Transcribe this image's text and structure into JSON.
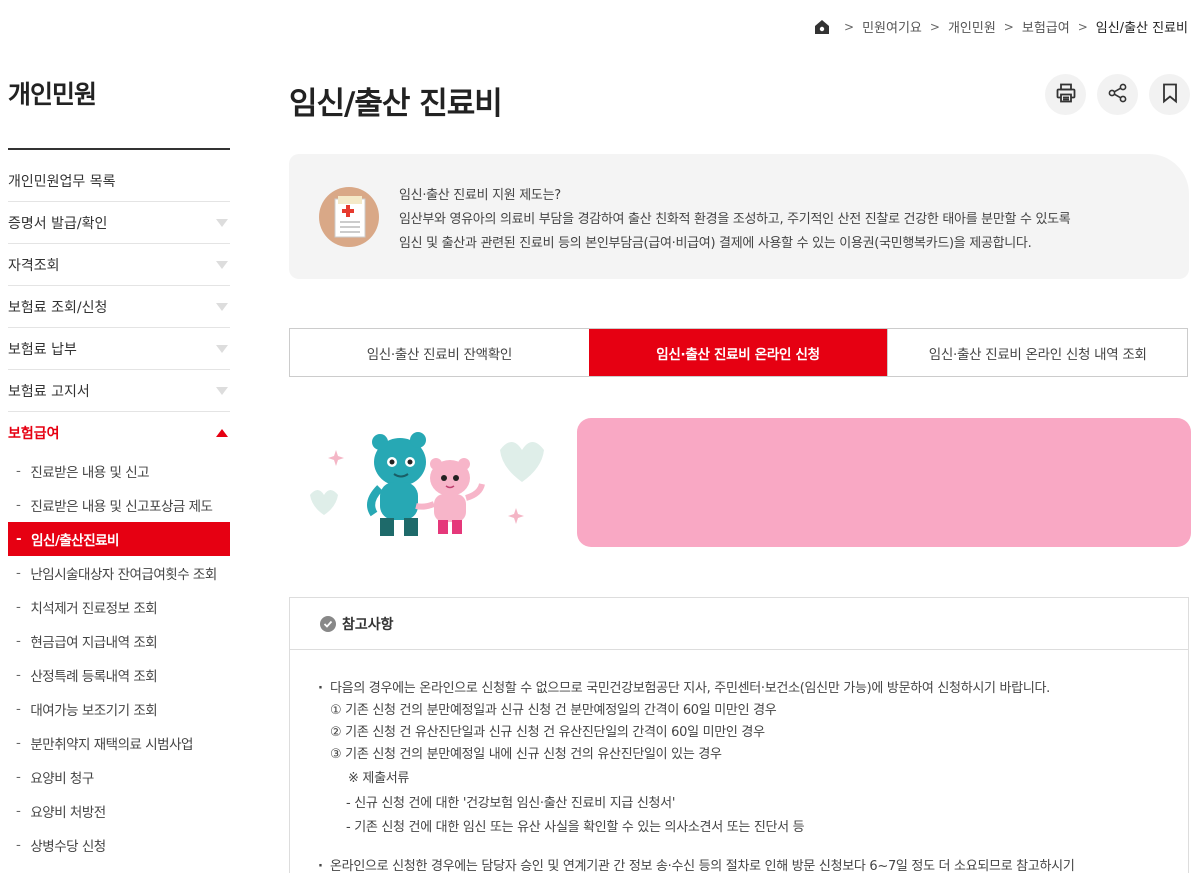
{
  "breadcrumb": {
    "items": [
      "민원여기요",
      "개인민원",
      "보험급여",
      "임신/출산 진료비"
    ]
  },
  "sidebar": {
    "title": "개인민원",
    "menu": [
      {
        "label": "개인민원업무 목록"
      },
      {
        "label": "증명서 발급/확인"
      },
      {
        "label": "자격조회"
      },
      {
        "label": "보험료 조회/신청"
      },
      {
        "label": "보험료 납부"
      },
      {
        "label": "보험료 고지서"
      },
      {
        "label": "보험급여"
      }
    ],
    "submenu": [
      "진료받은 내용 및 신고",
      "진료받은 내용 및 신고포상금 제도",
      "임신/출산진료비",
      "난임시술대상자 잔여급여횟수 조회",
      "치석제거 진료정보 조회",
      "현금급여 지급내역 조회",
      "산정특례 등록내역 조회",
      "대여가능 보조기기 조회",
      "분만취약지 재택의료 시범사업",
      "요양비 청구",
      "요양비 처방전",
      "상병수당 신청"
    ]
  },
  "page": {
    "title": "임신/출산 진료비"
  },
  "toolbar": {
    "print_icon": "print-icon",
    "share_icon": "share-icon",
    "bookmark_icon": "bookmark-icon"
  },
  "intro": {
    "line1": "임신·출산 진료비 지원 제도는?",
    "line2": "임산부와 영유아의 의료비 부담을 경감하여 출산 친화적 환경을 조성하고, 주기적인 산전 진찰로 건강한 태아를 분만할 수 있도록",
    "line3": "임신 및 출산과 관련된 진료비 등의 본인부담금(급여·비급여) 결제에 사용할 수 있는 이용권(국민행복카드)을 제공합니다."
  },
  "tabs": [
    {
      "label": "임신·출산 진료비 잔액확인"
    },
    {
      "label": "임신·출산 진료비 온라인 신청"
    },
    {
      "label": "임신·출산 진료비 온라인 신청 내역 조회"
    }
  ],
  "notice": {
    "title": "참고사항",
    "bullet1": "다음의 경우에는 온라인으로 신청할 수 없으므로 국민건강보험공단 지사, 주민센터·보건소(임신만 가능)에 방문하여 신청하시기 바랍니다.",
    "item1": "① 기존 신청 건의 분만예정일과 신규 신청 건 분만예정일의 간격이 60일 미만인 경우",
    "item2": "② 기존 신청 건 유산진단일과 신규 신청 건 유산진단일의 간격이 60일 미만인 경우",
    "item3": "③ 기존 신청 건의 분만예정일 내에 신규 신청 건의 유산진단일이 있는 경우",
    "docs_title": "※ 제출서류",
    "doc1": "- 신규 신청 건에 대한 '건강보험 임신·출산 진료비 지급 신청서'",
    "doc2": "- 기존 신청 건에 대한 임신 또는 유산 사실을 확인할 수 있는 의사소견서 또는 진단서 등",
    "bullet2": "온라인으로 신청한 경우에는 담당자 승인 및 연계기관 간 정보 송·수신 등의 절차로 인해 방문 신청보다 6~7일 정도 더 소요되므로 참고하시기"
  },
  "colors": {
    "accent": "#e60012",
    "banner": "#f9a8c4",
    "intro_bg": "#f4f4f4"
  }
}
